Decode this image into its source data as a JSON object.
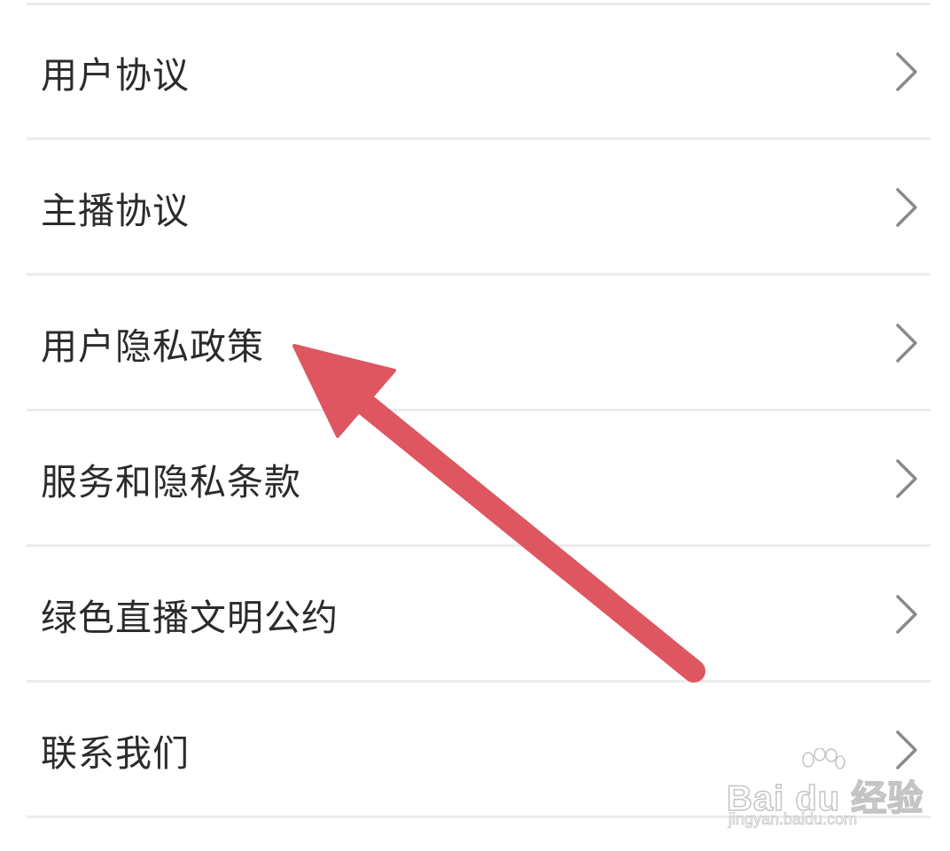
{
  "menu": {
    "items": [
      {
        "label": "用户协议",
        "icon": "chevron-right-icon"
      },
      {
        "label": "主播协议",
        "icon": "chevron-right-icon"
      },
      {
        "label": "用户隐私政策",
        "icon": "chevron-right-icon"
      },
      {
        "label": "服务和隐私条款",
        "icon": "chevron-right-icon"
      },
      {
        "label": "绿色直播文明公约",
        "icon": "chevron-right-icon"
      },
      {
        "label": "联系我们",
        "icon": "chevron-right-icon"
      }
    ]
  },
  "annotation": {
    "arrow_color": "#dd5660",
    "points_to": "用户隐私政策"
  },
  "watermark": {
    "logo": "Bai du 经验",
    "url": "jingyan.baidu.com"
  },
  "colors": {
    "background": "#ffffff",
    "divider": "#ececec",
    "text": "#2b2b2b",
    "chevron": "#8a8a8a",
    "arrow": "#dd5660"
  }
}
